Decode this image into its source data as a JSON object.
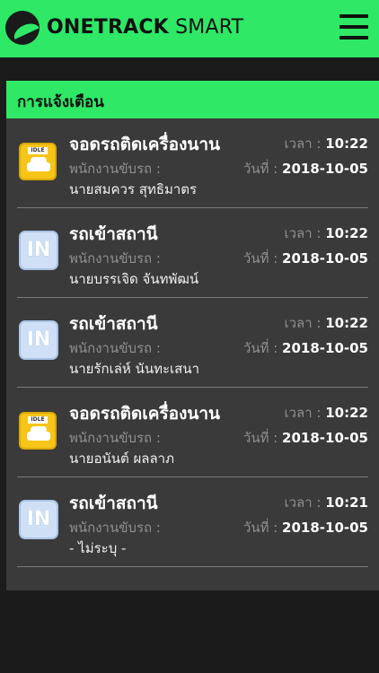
{
  "header": {
    "brand_bold": "ONETRACK",
    "brand_light": " SMART"
  },
  "panel": {
    "title": "การแจ้งเตือน"
  },
  "labels": {
    "driver": "พนักงานขับรถ :",
    "time": "เวลา : ",
    "date": "วันที่ : "
  },
  "notifications": [
    {
      "icon": "idle-car-icon",
      "idle_tag": "IDLE",
      "title": "จอดรถติดเครื่องนาน",
      "driver": "นายสมควร สุทธิมาตร",
      "time": "10:22",
      "date": "2018-10-05"
    },
    {
      "icon": "in-icon",
      "icon_text": "IN",
      "title": "รถเข้าสถานี",
      "driver": "นายบรรเจิด จันทพัฒน์",
      "time": "10:22",
      "date": "2018-10-05"
    },
    {
      "icon": "in-icon",
      "icon_text": "IN",
      "title": "รถเข้าสถานี",
      "driver": "นายรักเล่ห์ นันทะเสนา",
      "time": "10:22",
      "date": "2018-10-05"
    },
    {
      "icon": "idle-car-icon",
      "idle_tag": "IDLE",
      "title": "จอดรถติดเครื่องนาน",
      "driver": "นายอนันต์ ผลลาภ",
      "time": "10:22",
      "date": "2018-10-05"
    },
    {
      "icon": "in-icon",
      "icon_text": "IN",
      "title": "รถเข้าสถานี",
      "driver": "- ไม่ระบุ -",
      "time": "10:21",
      "date": "2018-10-05"
    }
  ]
}
